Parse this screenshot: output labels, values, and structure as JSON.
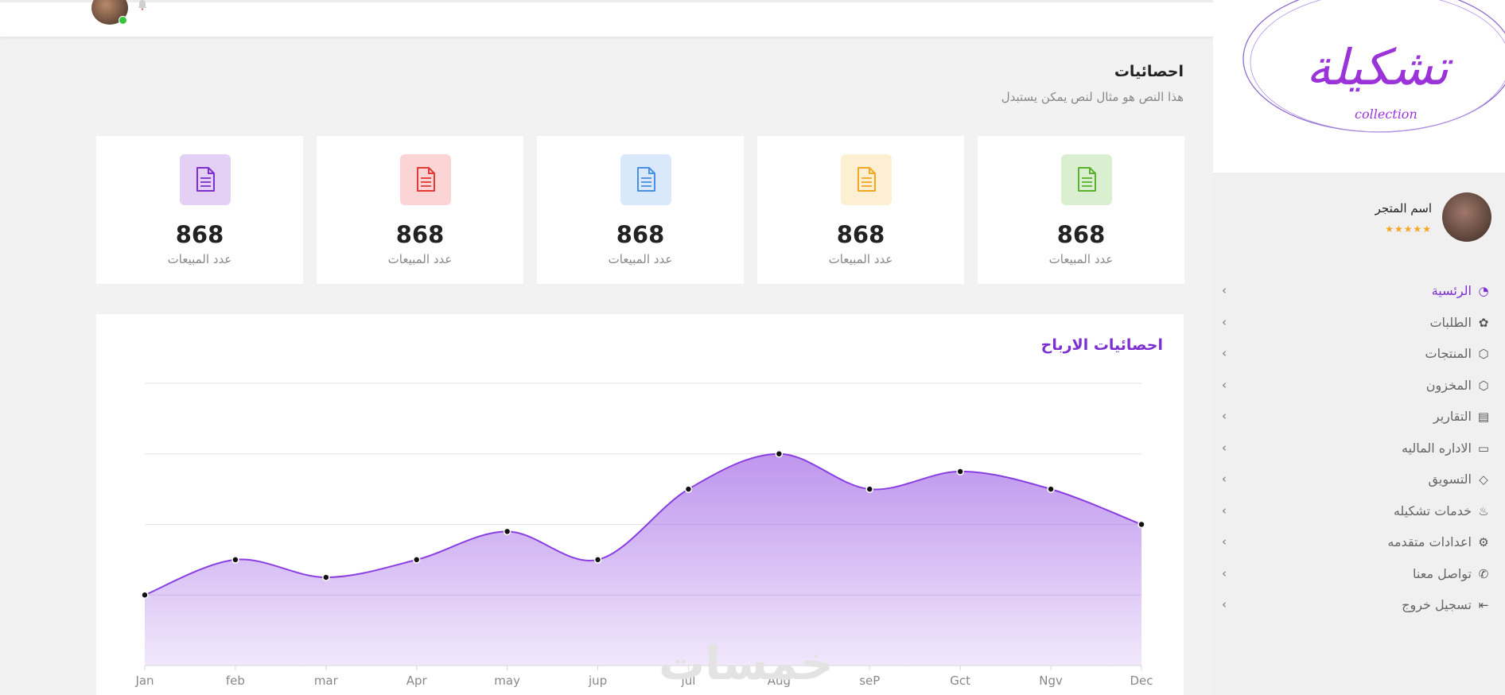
{
  "topbar": {
    "avatar_icon": "user-avatar-icon",
    "bell_icon": "bell-icon"
  },
  "sidebar": {
    "logo_text": "تشكيلة",
    "logo_subtext": "collection",
    "store_name": "اسم المتجر",
    "store_stars": "★★★★★",
    "items": [
      {
        "label": "الرئسية",
        "icon": "dashboard-icon",
        "active": true
      },
      {
        "label": "الطلبات",
        "icon": "orders-icon"
      },
      {
        "label": "المنتجات",
        "icon": "box-icon"
      },
      {
        "label": "المخزون",
        "icon": "inventory-icon"
      },
      {
        "label": "التقارير",
        "icon": "reports-icon"
      },
      {
        "label": "الاداره الماليه",
        "icon": "wallet-icon"
      },
      {
        "label": "التسويق",
        "icon": "marketing-icon"
      },
      {
        "label": "خدمات تشكيله",
        "icon": "services-icon"
      },
      {
        "label": "اعدادات متقدمه",
        "icon": "gear-icon"
      },
      {
        "label": "تواصل معنا",
        "icon": "phone-icon"
      },
      {
        "label": "تسجيل خروج",
        "icon": "logout-icon"
      }
    ]
  },
  "header": {
    "title": "احصائيات",
    "subtitle": "هذا النص هو مثال لنص يمكن يستبدل"
  },
  "cards": [
    {
      "value": "868",
      "label": "عدد المبيعات",
      "icon": "document-icon",
      "color": "#7d2fd0",
      "bg": "#e4cff5"
    },
    {
      "value": "868",
      "label": "عدد المبيعات",
      "icon": "document-icon",
      "color": "#e53935",
      "bg": "#fbd5d5"
    },
    {
      "value": "868",
      "label": "عدد المبيعات",
      "icon": "document-icon",
      "color": "#4a90e2",
      "bg": "#d9e9fb"
    },
    {
      "value": "868",
      "label": "عدد المبيعات",
      "icon": "document-icon",
      "color": "#f5a623",
      "bg": "#fdf0d2"
    },
    {
      "value": "868",
      "label": "عدد المبيعات",
      "icon": "document-icon",
      "color": "#5bb12f",
      "bg": "#d9efcf"
    }
  ],
  "chart_title": "احصائيات الارباح",
  "watermark": "خمسات",
  "chart_data": {
    "type": "area",
    "categories": [
      "Jan",
      "feb",
      "mar",
      "Apr",
      "may",
      "jup",
      "jul",
      "Aug",
      "seP",
      "Gct",
      "Ngv",
      "Dec"
    ],
    "values": [
      10,
      15,
      12.5,
      15,
      19,
      15,
      25,
      30,
      25,
      27.5,
      25,
      20
    ],
    "ylim": [
      0,
      40
    ],
    "grid": true,
    "color": "#8a3fe0"
  }
}
